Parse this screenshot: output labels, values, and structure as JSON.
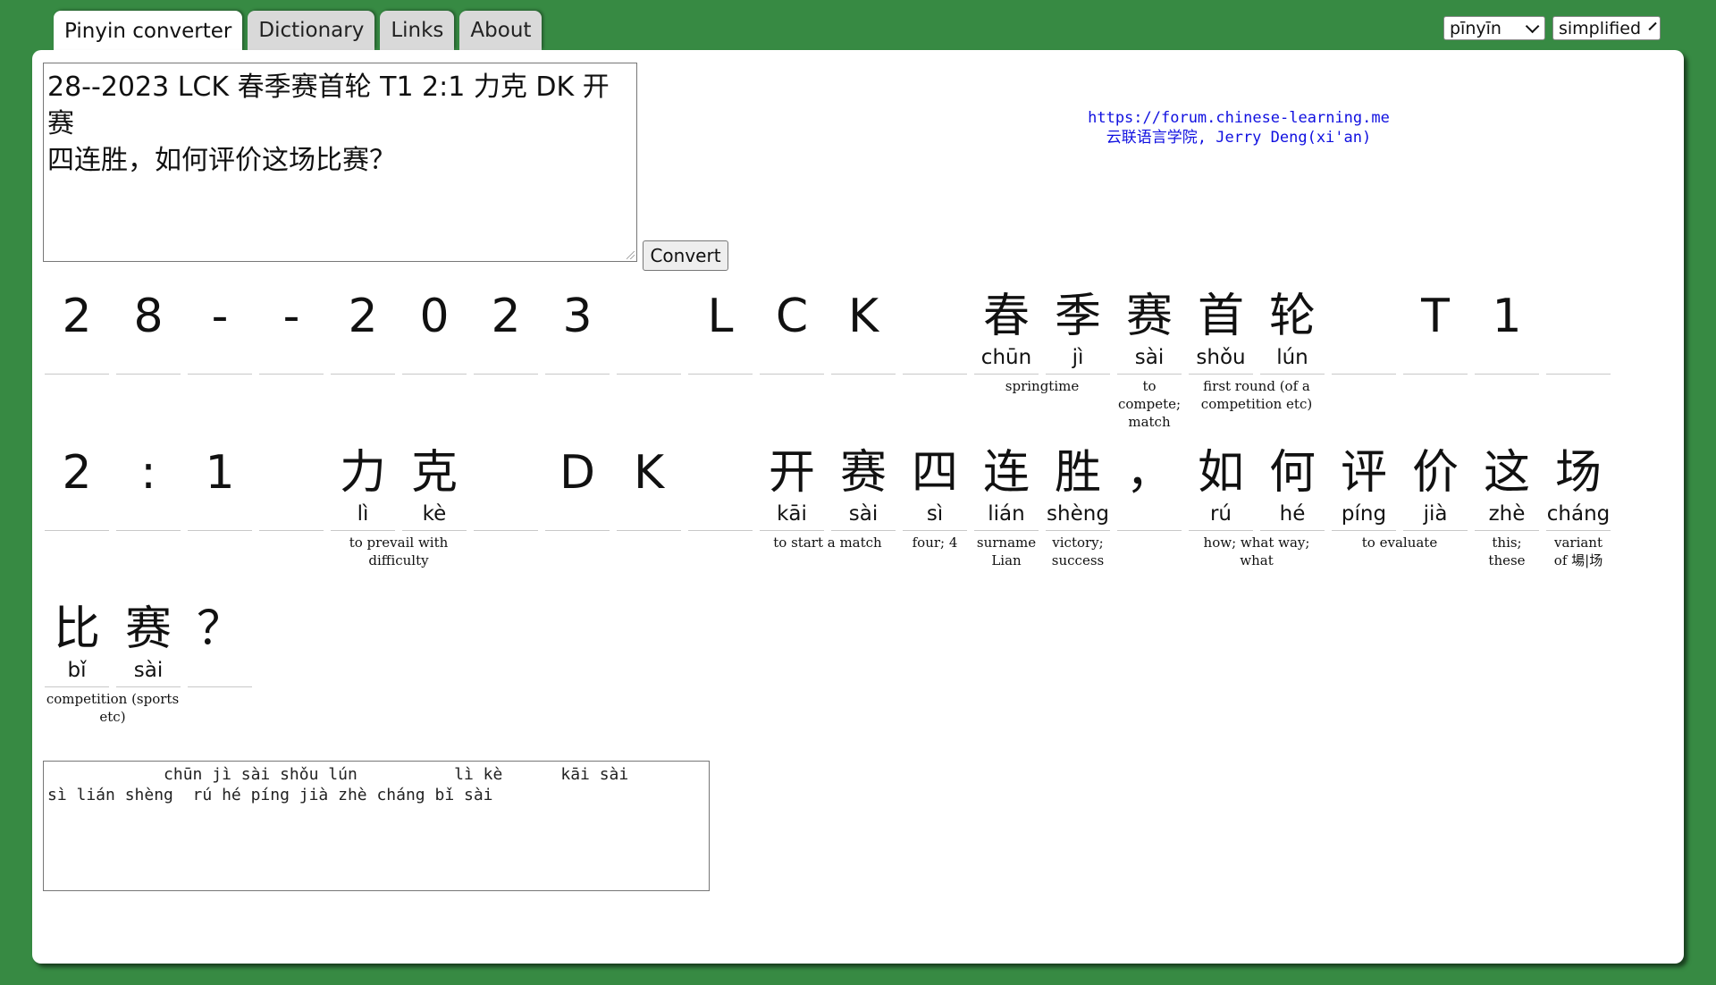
{
  "tabs": [
    "Pinyin converter",
    "Dictionary",
    "Links",
    "About"
  ],
  "selects": {
    "tone_mode": "pīnyīn",
    "script": "simplified"
  },
  "input_text": "28--2023 LCK 春季赛首轮 T1 2:1 力克 DK 开赛四连胜，如何评价这场比赛？",
  "input_lines": [
    "28--2023 LCK 春季赛首轮 T1 2:1 力克 DK 开赛",
    "四连胜，如何评价这场比赛？"
  ],
  "convert_label": "Convert",
  "credits": {
    "url": "https://forum.chinese-learning.me",
    "author": "云联语言学院, Jerry Deng(xi'an)"
  },
  "rows": [
    [
      {
        "chars": [
          [
            "2",
            ""
          ]
        ],
        "def": ""
      },
      {
        "chars": [
          [
            "8",
            ""
          ]
        ],
        "def": ""
      },
      {
        "chars": [
          [
            "-",
            ""
          ]
        ],
        "def": ""
      },
      {
        "chars": [
          [
            "-",
            ""
          ]
        ],
        "def": ""
      },
      {
        "chars": [
          [
            "2",
            ""
          ]
        ],
        "def": ""
      },
      {
        "chars": [
          [
            "0",
            ""
          ]
        ],
        "def": ""
      },
      {
        "chars": [
          [
            "2",
            ""
          ]
        ],
        "def": ""
      },
      {
        "chars": [
          [
            "3",
            ""
          ]
        ],
        "def": ""
      },
      {
        "chars": [
          [
            " ",
            ""
          ]
        ],
        "def": ""
      },
      {
        "chars": [
          [
            "L",
            ""
          ]
        ],
        "def": ""
      },
      {
        "chars": [
          [
            "C",
            ""
          ]
        ],
        "def": ""
      },
      {
        "chars": [
          [
            "K",
            ""
          ]
        ],
        "def": ""
      },
      {
        "chars": [
          [
            " ",
            ""
          ]
        ],
        "def": ""
      },
      {
        "chars": [
          [
            "春",
            "chūn"
          ],
          [
            "季",
            "jì"
          ]
        ],
        "def": "springtime"
      },
      {
        "chars": [
          [
            "赛",
            "sài"
          ]
        ],
        "def": "to compete; match"
      },
      {
        "chars": [
          [
            "首",
            "shǒu"
          ],
          [
            "轮",
            "lún"
          ]
        ],
        "def": "first round (of a competition etc)"
      },
      {
        "chars": [
          [
            " ",
            ""
          ]
        ],
        "def": ""
      },
      {
        "chars": [
          [
            "T",
            ""
          ]
        ],
        "def": ""
      },
      {
        "chars": [
          [
            "1",
            ""
          ]
        ],
        "def": ""
      },
      {
        "chars": [
          [
            " ",
            ""
          ]
        ],
        "def": ""
      }
    ],
    [
      {
        "chars": [
          [
            "2",
            ""
          ]
        ],
        "def": ""
      },
      {
        "chars": [
          [
            ":",
            ""
          ]
        ],
        "def": ""
      },
      {
        "chars": [
          [
            "1",
            ""
          ]
        ],
        "def": ""
      },
      {
        "chars": [
          [
            " ",
            ""
          ]
        ],
        "def": ""
      },
      {
        "chars": [
          [
            "力",
            "lì"
          ],
          [
            "克",
            "kè"
          ]
        ],
        "def": "to prevail with difficulty"
      },
      {
        "chars": [
          [
            " ",
            ""
          ]
        ],
        "def": ""
      },
      {
        "chars": [
          [
            "D",
            ""
          ]
        ],
        "def": ""
      },
      {
        "chars": [
          [
            "K",
            ""
          ]
        ],
        "def": ""
      },
      {
        "chars": [
          [
            " ",
            ""
          ]
        ],
        "def": ""
      },
      {
        "chars": [
          [
            "开",
            "kāi"
          ],
          [
            "赛",
            "sài"
          ]
        ],
        "def": "to start a match"
      },
      {
        "chars": [
          [
            "四",
            "sì"
          ]
        ],
        "def": "four; 4"
      },
      {
        "chars": [
          [
            "连",
            "lián"
          ]
        ],
        "def": "surname Lian"
      },
      {
        "chars": [
          [
            "胜",
            "shèng"
          ]
        ],
        "def": "victory; success"
      },
      {
        "chars": [
          [
            "，",
            ""
          ]
        ],
        "def": ""
      },
      {
        "chars": [
          [
            "如",
            "rú"
          ],
          [
            "何",
            "hé"
          ]
        ],
        "def": "how; what way; what"
      },
      {
        "chars": [
          [
            "评",
            "píng"
          ],
          [
            "价",
            "jià"
          ]
        ],
        "def": "to evaluate"
      },
      {
        "chars": [
          [
            "这",
            "zhè"
          ]
        ],
        "def": "this; these"
      },
      {
        "chars": [
          [
            "场",
            "cháng"
          ]
        ],
        "def": "variant of 場|场"
      }
    ],
    [
      {
        "chars": [
          [
            "比",
            "bǐ"
          ],
          [
            "赛",
            "sài"
          ]
        ],
        "def": "competition (sports etc)"
      },
      {
        "chars": [
          [
            "？",
            ""
          ]
        ],
        "def": ""
      }
    ]
  ],
  "output_text": "            chūn jì sài shǒu lún          lì kè      kāi sài\nsì lián shèng  rú hé píng jià zhè cháng bǐ sài"
}
